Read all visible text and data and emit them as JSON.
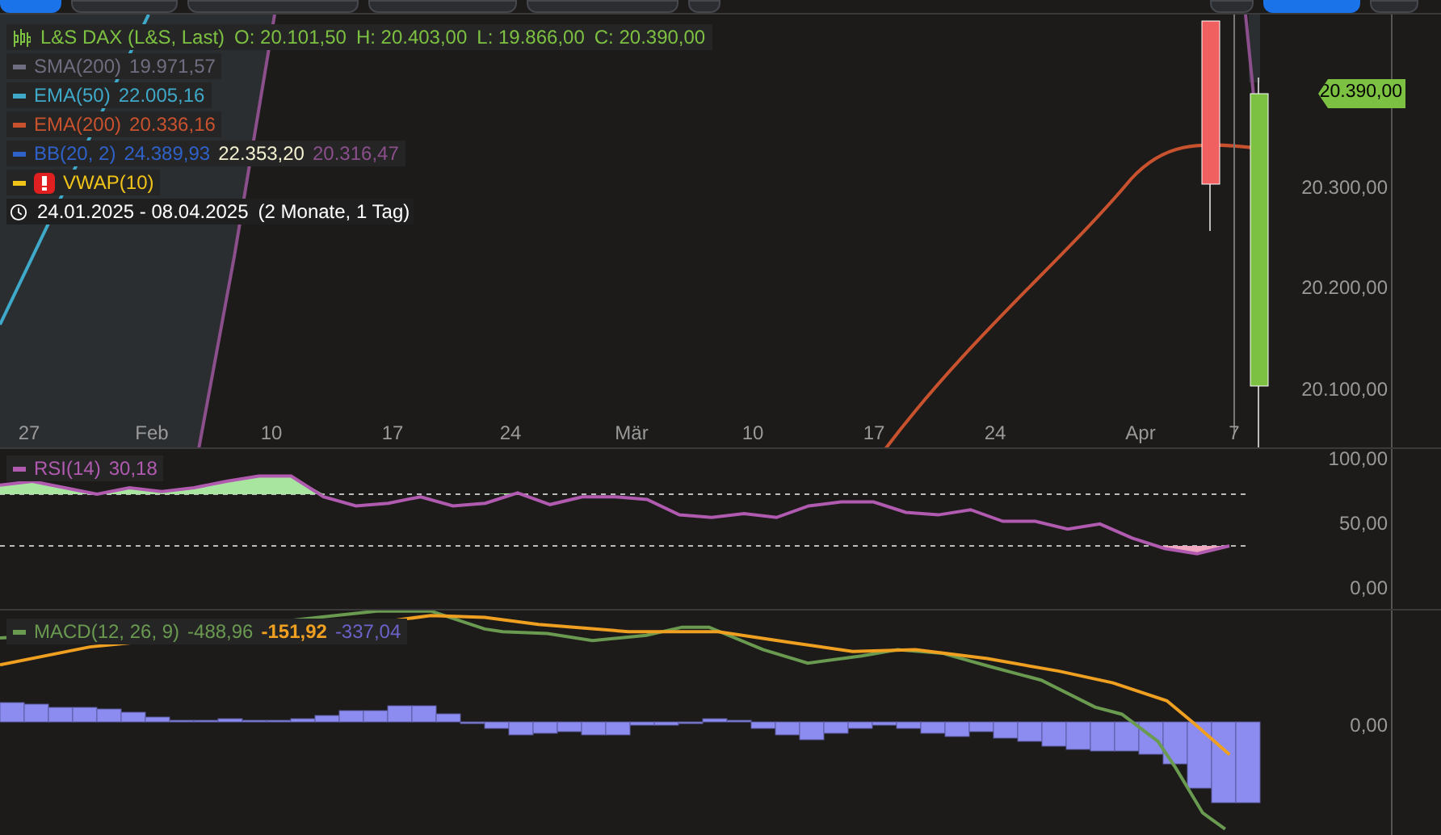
{
  "toolbar": {
    "buttons": [
      {
        "selected": true
      },
      {
        "selected": false
      },
      {
        "selected": false
      },
      {
        "selected": false
      },
      {
        "selected": false
      },
      {
        "selected": false
      },
      {
        "selected": false
      },
      {
        "selected": true
      },
      {
        "selected": false
      }
    ]
  },
  "instrument": {
    "name": "L&S DAX (L&S, Last)",
    "ohlc": [
      "O: 20.101,50",
      "H: 20.403,00",
      "L: 19.866,00",
      "C: 20.390,00"
    ],
    "color": "#7dc142"
  },
  "indicators": [
    {
      "name": "SMA(200)",
      "color": "#6e6e80",
      "values": [
        {
          "text": "19.971,57",
          "color": "#6e6e80"
        }
      ]
    },
    {
      "name": "EMA(50)",
      "color": "#3fa9c9",
      "values": [
        {
          "text": "22.005,16",
          "color": "#3fa9c9"
        }
      ]
    },
    {
      "name": "EMA(200)",
      "color": "#c9522e",
      "values": [
        {
          "text": "20.336,16",
          "color": "#c9522e"
        }
      ]
    },
    {
      "name": "BB(20, 2)",
      "color": "#2f62c9",
      "values": [
        {
          "text": "24.389,93",
          "color": "#2f62c9"
        },
        {
          "text": "22.353,20",
          "color": "#f4f1d0"
        },
        {
          "text": "20.316,47",
          "color": "#8b4f8b"
        }
      ]
    },
    {
      "name": "VWAP(10)",
      "color": "#f0c419",
      "warning": true
    }
  ],
  "date_range": {
    "range": "24.01.2025 - 08.04.2025",
    "duration": "(2 Monate, 1 Tag)"
  },
  "price_axis": [
    "20.300,00",
    "20.200,00",
    "20.100,00"
  ],
  "last_price": "20.390,00",
  "time_axis": [
    "27",
    "Feb",
    "10",
    "17",
    "24",
    "Mär",
    "10",
    "17",
    "24",
    "Apr",
    "7"
  ],
  "rsi": {
    "value": "30,18",
    "chart_data": {
      "type": "line",
      "ylim": [
        0,
        100
      ],
      "yticks": [
        {
          "value": 100,
          "label": "100,00"
        },
        {
          "value": 50,
          "label": "50,00"
        },
        {
          "value": 0,
          "label": "0,00"
        }
      ],
      "series": [
        {
          "name": "RSI(14)",
          "color": "#b05ab0",
          "values": [
            77,
            80,
            75,
            70,
            75,
            72,
            75,
            80,
            84,
            84,
            68,
            61,
            63,
            68,
            61,
            63,
            71,
            62,
            68,
            68,
            66,
            54,
            52,
            55,
            52,
            61,
            64,
            64,
            56,
            54,
            58,
            49,
            49,
            43,
            47,
            36,
            28,
            24,
            30
          ]
        }
      ]
    }
  },
  "macd": {
    "name": "MACD(12, 26, 9)",
    "color": "#6a9a50",
    "values": [
      {
        "text": "-488,96",
        "color": "#6a9a50"
      },
      {
        "text": "-151,92",
        "color": "#f0a020"
      },
      {
        "text": "-337,04",
        "color": "#6b63c9"
      }
    ],
    "axis": [
      "0,00"
    ]
  }
}
